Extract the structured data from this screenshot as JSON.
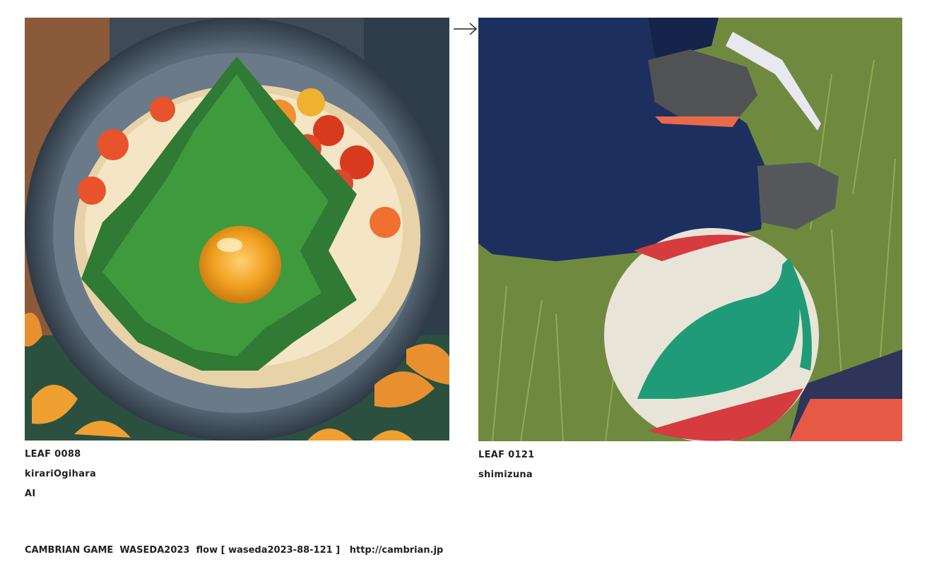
{
  "left_leaf": {
    "leaf_id": "LEAF 0088",
    "author": "kirariOgihara",
    "tag": "AI",
    "image_description": "plate with greens, egg yolk and tomatoes"
  },
  "right_leaf": {
    "leaf_id": "LEAF 0121",
    "author": "shimizuna",
    "image_description": "volleyball on grass next to a leg in navy pants"
  },
  "arrow": {
    "icon": "right-arrow-icon"
  },
  "footer": {
    "text": "CAMBRIAN GAME  WASEDA2023  flow [ waseda2023-88-121 ]",
    "link": "http://cambrian.jp"
  },
  "colors": {
    "text": "#222222",
    "background": "#ffffff"
  }
}
